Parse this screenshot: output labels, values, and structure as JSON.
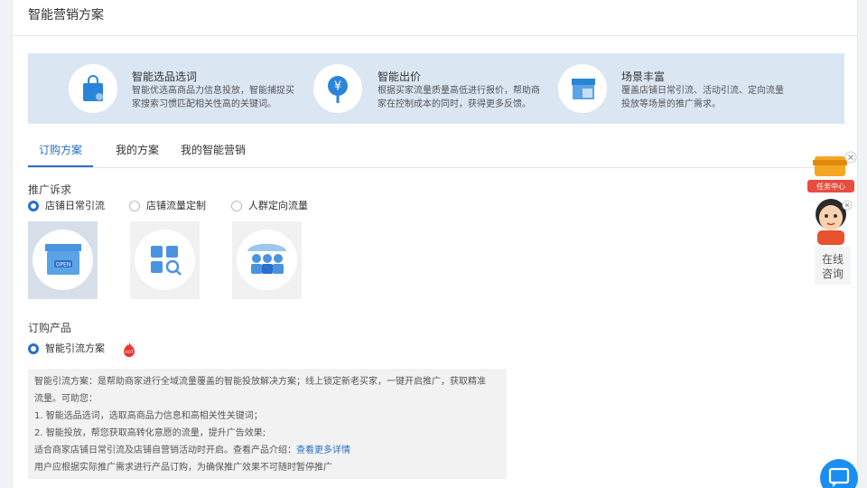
{
  "page": {
    "title": "智能营销方案"
  },
  "banner": {
    "features": [
      {
        "title": "智能选品选词",
        "desc_line1": "智能优选高商品力信息投放，智能捕捉买",
        "desc_line2": "家搜索习惯匹配相关性高的关键词。",
        "icon": "shopping-bag-icon"
      },
      {
        "title": "智能出价",
        "desc_line1": "根据买家流量质量高低进行报价，帮助商",
        "desc_line2": "家在控制成本的同时，获得更多反馈。",
        "icon": "yuan-price-tag-icon"
      },
      {
        "title": "场景丰富",
        "desc_line1": "覆盖店铺日常引流、活动引流、定向流量",
        "desc_line2": "投放等场景的推广需求。",
        "icon": "storefront-icon"
      }
    ]
  },
  "tabs": [
    {
      "label": "订购方案",
      "active": true
    },
    {
      "label": "我的方案",
      "active": false
    },
    {
      "label": "我的智能营销",
      "active": false
    }
  ],
  "promo": {
    "label": "推广诉求",
    "options": [
      {
        "label": "店铺日常引流",
        "selected": true
      },
      {
        "label": "店铺流量定制",
        "selected": false
      },
      {
        "label": "人群定向流量",
        "selected": false
      }
    ]
  },
  "product": {
    "label": "订购产品",
    "option": "智能引流方案",
    "badge": "HOT"
  },
  "description": {
    "line1": "智能引流方案：是帮助商家进行全域流量覆盖的智能投放解决方案；线上锁定新老买家，一键开启推广，获取精准",
    "line2": "流量。可助您：",
    "line3": "1. 智能选品选词，选取高商品力信息和高相关性关键词；",
    "line4": "2. 智能投放，帮您获取高转化意愿的流量，提升广告效果;",
    "line5_prefix": "适合商家店铺日常引流及店铺自营销活动时开启。查看产品介绍：",
    "line5_link": "查看更多详情",
    "line6": "用户应根据实际推广需求进行产品订购，为确保推广效果不可随时暂停推广"
  },
  "sidebar": {
    "task_center": "任务中心",
    "consult_line1": "在线",
    "consult_line2": "咨询"
  },
  "colors": {
    "accent": "#2a6fc9",
    "banner_bg": "#dbe6f3",
    "fab": "#1b8ef2",
    "hot": "#e33"
  }
}
